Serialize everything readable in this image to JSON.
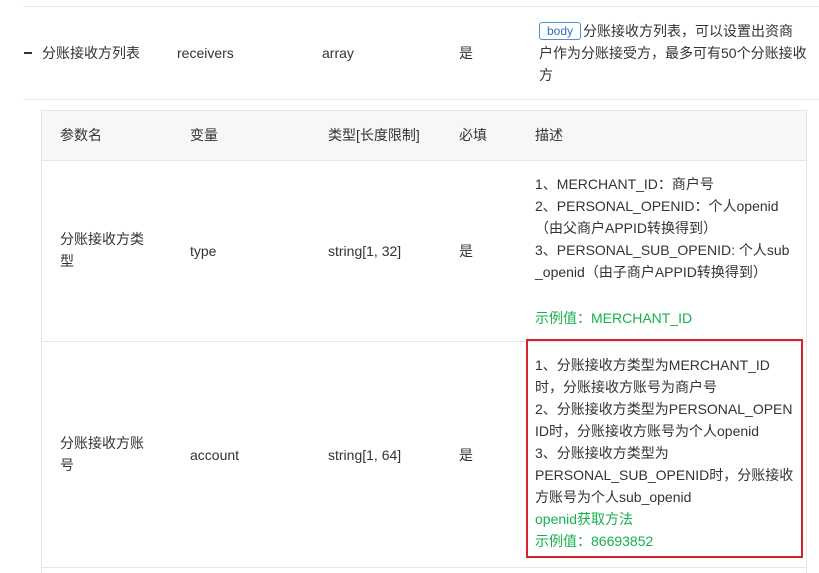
{
  "outer_row": {
    "name": "分账接收方列表",
    "variable": "receivers",
    "type": "array",
    "required": "是",
    "badge": "body",
    "desc_line1": "分账接收方列表，可以设置出资商",
    "desc_line2": "户作为分账接受方，最多可有50个分账接收",
    "desc_line3": "方"
  },
  "nested_header": {
    "col_name": "参数名",
    "col_variable": "变量",
    "col_type": "类型[长度限制]",
    "col_required": "必填",
    "col_desc": "描述"
  },
  "rows": [
    {
      "name_line1": "分账接收方类",
      "name_line2": "型",
      "variable": "type",
      "type": "string[1, 32]",
      "required": "是",
      "desc_lines": [
        "1、MERCHANT_ID：商户号",
        "2、PERSONAL_OPENID：个人openid",
        "（由父商户APPID转换得到）",
        "3、PERSONAL_SUB_OPENID: 个人sub",
        "_openid（由子商户APPID转换得到）"
      ],
      "example": "示例值：MERCHANT_ID"
    },
    {
      "name_line1": "分账接收方账",
      "name_line2": "号",
      "variable": "account",
      "type": "string[1, 64]",
      "required": "是",
      "desc_lines": [
        "1、分账接收方类型为MERCHANT_ID",
        "时，分账接收方账号为商户号",
        "2、分账接收方类型为PERSONAL_OPEN",
        "ID时，分账接收方账号为个人openid",
        "3、分账接收方类型为",
        "PERSONAL_SUB_OPENID时，分账接收",
        "方账号为个人sub_openid"
      ],
      "link": "openid获取方法",
      "example": "示例值：86693852"
    }
  ],
  "colors": {
    "highlight_border": "#d8232a",
    "example_text": "#16b14c",
    "badge_border": "#4a90e2"
  }
}
